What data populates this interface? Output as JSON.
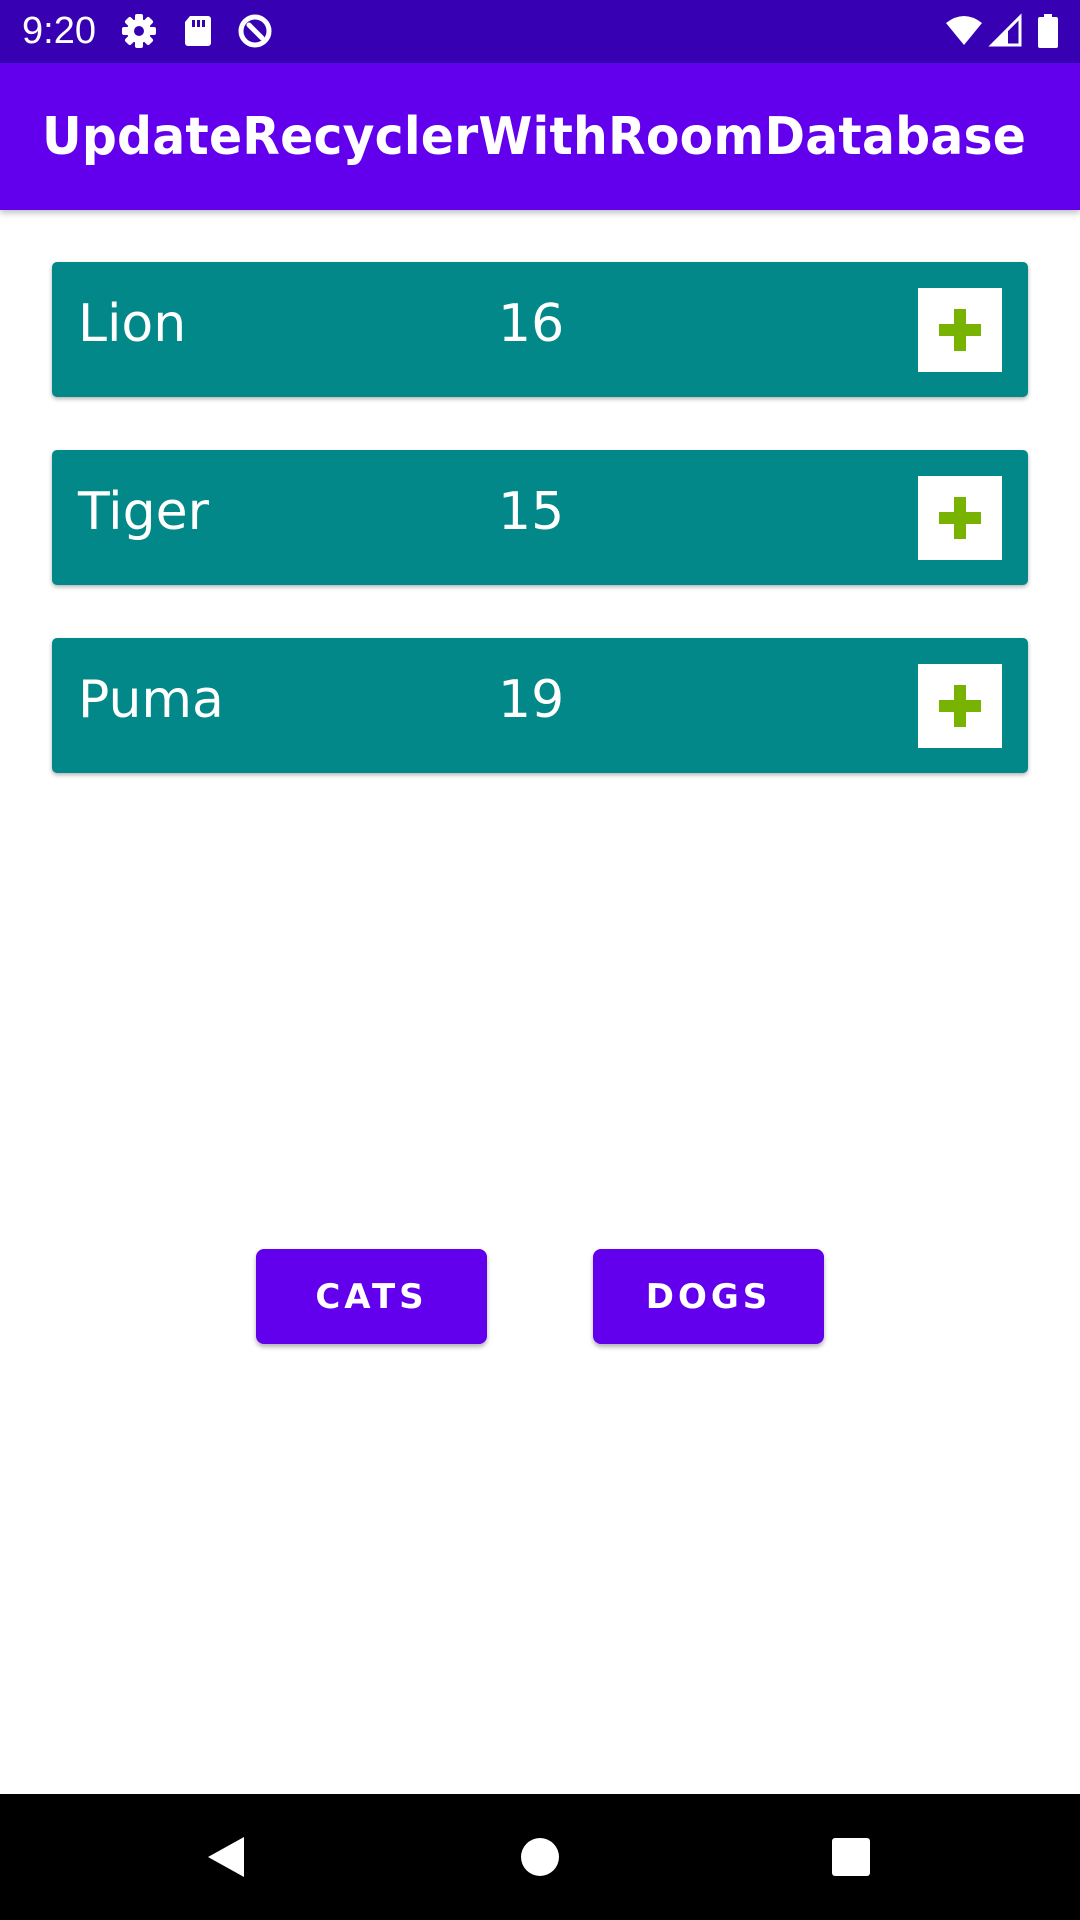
{
  "status_bar": {
    "time": "9:20",
    "icons": [
      "gear-icon",
      "sd-card-icon",
      "data-saver-icon",
      "wifi-icon",
      "signal-icon",
      "battery-icon"
    ]
  },
  "app_bar": {
    "title": "UpdateRecyclerWithRoomDatabase"
  },
  "colors": {
    "status_bar": "#3700b3",
    "app_bar": "#6200ee",
    "card": "#028888",
    "plus": "#77b300",
    "button": "#6200ee"
  },
  "animals": [
    {
      "name": "Lion",
      "count": "16"
    },
    {
      "name": "Tiger",
      "count": "15"
    },
    {
      "name": "Puma",
      "count": "19"
    }
  ],
  "buttons": {
    "cats_label": "CATS",
    "dogs_label": "DOGS"
  },
  "nav_bar": {
    "icons": [
      "back-icon",
      "home-icon",
      "recents-icon"
    ]
  }
}
